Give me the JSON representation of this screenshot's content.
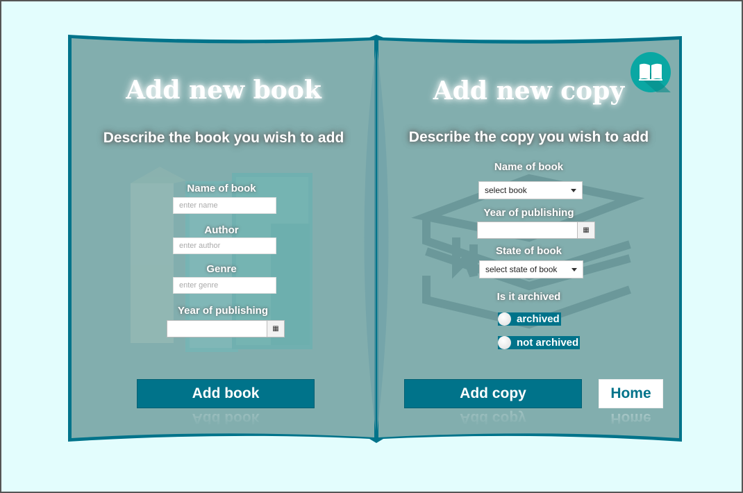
{
  "colors": {
    "accent": "#00738a",
    "page": "#82aeae",
    "background": "#e3fdfd",
    "badge": "#0aa7a3"
  },
  "left": {
    "title": "Add new book",
    "subtitle": "Describe the book you wish to add",
    "name_label": "Name of book",
    "name_placeholder": "enter name",
    "author_label": "Author",
    "author_placeholder": "enter author",
    "genre_label": "Genre",
    "genre_placeholder": "enter genre",
    "year_label": "Year of publishing",
    "year_value": "",
    "add_button": "Add book"
  },
  "right": {
    "title": "Add new copy",
    "subtitle": "Describe the copy you wish to add",
    "name_label": "Name of book",
    "book_select": "select book",
    "year_label": "Year of publishing",
    "year_value": "",
    "state_label": "State of book",
    "state_select": "select state of book",
    "archived_label": "Is it archived",
    "radio_archived": "archived",
    "radio_not_archived": "not archived",
    "add_button": "Add copy",
    "home_button": "Home"
  },
  "icons": {
    "badge": "open-book-icon",
    "calendar": "calendar-icon",
    "dropdown": "caret-down-icon"
  }
}
